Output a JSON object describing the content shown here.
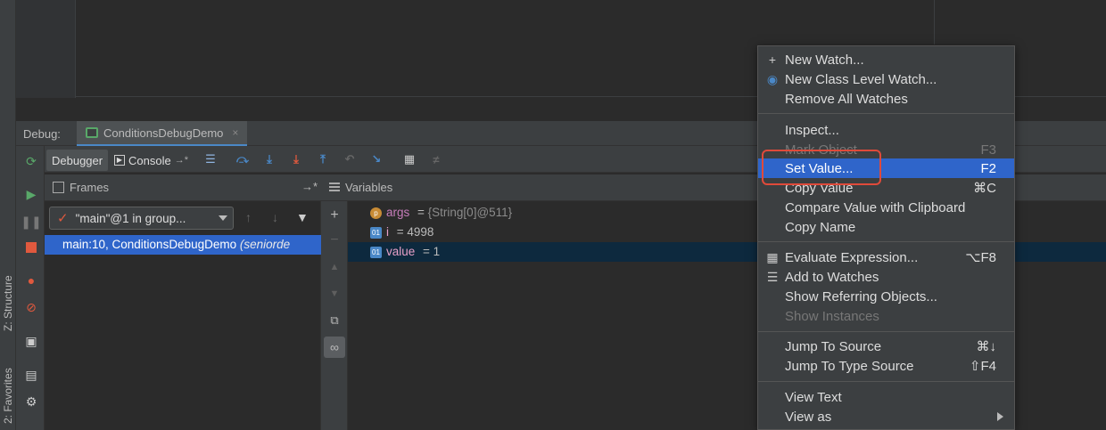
{
  "side_tabs": {
    "structure": "Z: Structure",
    "favorites": "2: Favorites"
  },
  "debug": {
    "label": "Debug:",
    "session_tab": "ConditionsDebugDemo",
    "close": "×"
  },
  "toolbar": {
    "debugger_tab": "Debugger",
    "console_tab": "Console"
  },
  "frames": {
    "title": "Frames",
    "thread": "\"main\"@1 in group...",
    "row": "main:10, ConditionsDebugDemo",
    "row_pkg": "(seniorde"
  },
  "variables": {
    "title": "Variables",
    "rows": [
      {
        "badge": "p",
        "name": "args",
        "eq": " = ",
        "value": "{String[0]@511}"
      },
      {
        "badge": "01",
        "name": "i",
        "eq": " = ",
        "value": "4998"
      },
      {
        "badge": "01",
        "name": "value",
        "eq": " = ",
        "value": "1"
      }
    ]
  },
  "menu": {
    "new_watch": "New Watch...",
    "new_class_watch": "New Class Level Watch...",
    "remove_watches": "Remove All Watches",
    "inspect": "Inspect...",
    "mark_object": "Mark Object",
    "mark_object_sc": "F3",
    "set_value": "Set Value...",
    "set_value_sc": "F2",
    "copy_value": "Copy Value",
    "copy_value_sc": "⌘C",
    "compare_clipboard": "Compare Value with Clipboard",
    "copy_name": "Copy Name",
    "evaluate": "Evaluate Expression...",
    "evaluate_sc": "⌥F8",
    "add_watches": "Add to Watches",
    "referring": "Show Referring Objects...",
    "instances": "Show Instances",
    "jump_source": "Jump To Source",
    "jump_source_sc": "⌘↓",
    "jump_type": "Jump To Type Source",
    "jump_type_sc": "⇧F4",
    "view_text": "View Text",
    "view_as": "View as"
  },
  "colors": {
    "selection": "#2f65ca",
    "callout": "#e04a3a",
    "panel": "#3c3f41",
    "editor": "#2b2b2b"
  }
}
